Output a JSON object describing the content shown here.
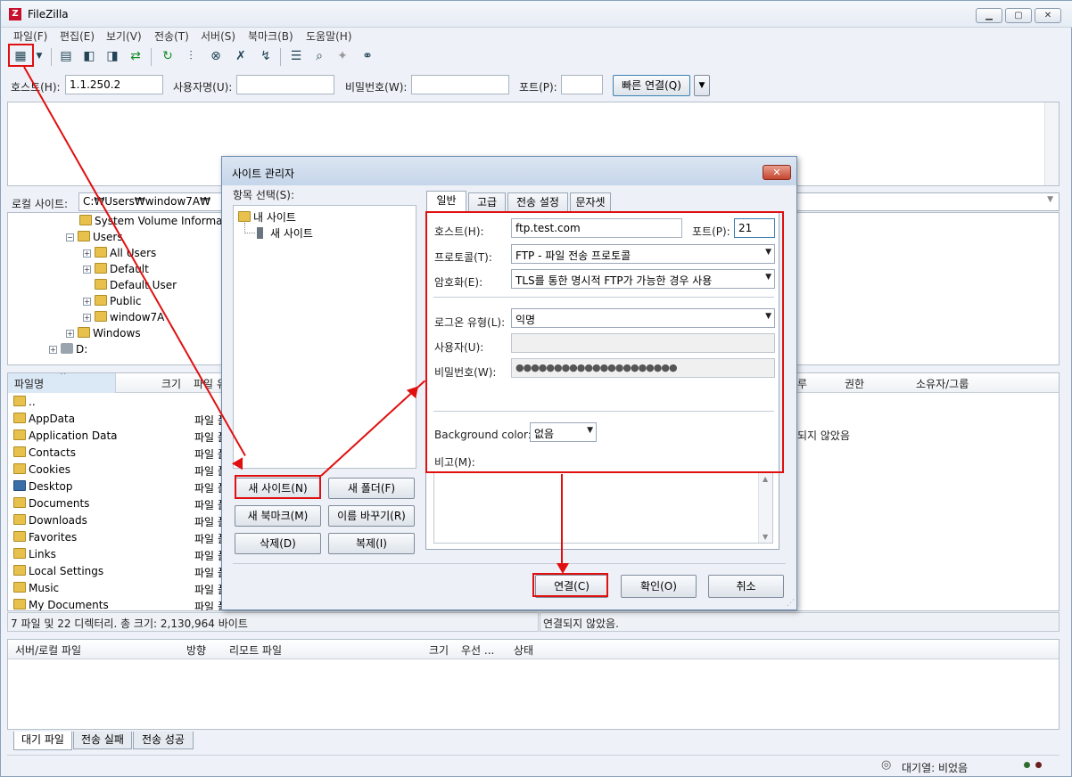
{
  "window": {
    "title": "FileZilla",
    "app_icon": "Z"
  },
  "menu": [
    "파일(F)",
    "편집(E)",
    "보기(V)",
    "전송(T)",
    "서버(S)",
    "북마크(B)",
    "도움말(H)"
  ],
  "quickconnect": {
    "host_label": "호스트(H):",
    "host_value": "1.1.250.2",
    "user_label": "사용자명(U):",
    "user_value": "",
    "pass_label": "비밀번호(W):",
    "pass_value": "",
    "port_label": "포트(P):",
    "port_value": "",
    "connect_label": "빠른 연결(Q)"
  },
  "local": {
    "site_label": "로컬 사이트:",
    "path": "C:₩Users₩window7A₩",
    "tree": [
      "System Volume Informati",
      "Users",
      "All Users",
      "Default",
      "Default User",
      "Public",
      "window7A",
      "Windows",
      "D:"
    ],
    "columns": {
      "name": "파일명",
      "size": "크기",
      "type": "파일 유"
    },
    "files": [
      "..",
      "AppData",
      "Application Data",
      "Contacts",
      "Cookies",
      "Desktop",
      "Documents",
      "Downloads",
      "Favorites",
      "Links",
      "Local Settings",
      "Music",
      "My Documents"
    ],
    "file_type": "파일 폴",
    "status": "7 파일 및 22 디렉터리. 총 크기: 2,130,964 바이트"
  },
  "remote": {
    "columns": {
      "perm": "권한",
      "owner": "소유자/그룹",
      "trunc": "루"
    },
    "message": "되지 않았음",
    "status": "연결되지 않았음."
  },
  "queue": {
    "columns": [
      "서버/로컬 파일",
      "방향",
      "리모트 파일",
      "크기",
      "우선 ...",
      "상태"
    ],
    "tabs": [
      "대기 파일",
      "전송 실패",
      "전송 성공"
    ],
    "status": "대기열: 비었음"
  },
  "dialog": {
    "title": "사이트 관리자",
    "select_label": "항목 선택(S):",
    "tree_root": "내 사이트",
    "tree_child": "새 사이트",
    "buttons": {
      "new_site": "새 사이트(N)",
      "new_folder": "새 폴더(F)",
      "new_bookmark": "새 북마크(M)",
      "rename": "이름 바꾸기(R)",
      "delete": "삭제(D)",
      "copy": "복제(I)",
      "connect": "연결(C)",
      "ok": "확인(O)",
      "cancel": "취소"
    },
    "tabs": [
      "일반",
      "고급",
      "전송 설정",
      "문자셋"
    ],
    "form": {
      "host_label": "호스트(H):",
      "host_value": "ftp.test.com",
      "port_label": "포트(P):",
      "port_value": "21",
      "protocol_label": "프로토콜(T):",
      "protocol_value": "FTP - 파일 전송 프로토콜",
      "encryption_label": "암호화(E):",
      "encryption_value": "TLS를 통한 명시적 FTP가 가능한 경우 사용",
      "logon_label": "로그온 유형(L):",
      "logon_value": "익명",
      "user_label": "사용자(U):",
      "user_value": "",
      "pass_label": "비밀번호(W):",
      "pass_value": "●●●●●●●●●●●●●●●●●●●●●",
      "bg_label": "Background color:",
      "bg_value": "없음",
      "comment_label": "비고(M):"
    }
  },
  "colors": {
    "annotation": "#e01010",
    "dialog_border": "#6d8cb4",
    "window_bg": "#eef2f8"
  }
}
